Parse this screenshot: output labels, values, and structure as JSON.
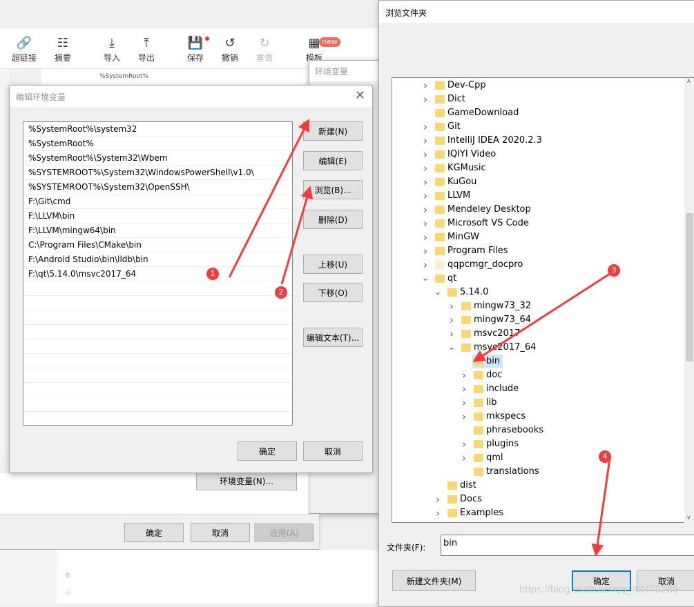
{
  "toolbar": {
    "items": [
      {
        "label": "超链接",
        "icon": "link-icon"
      },
      {
        "label": "摘要",
        "icon": "summary-icon"
      },
      {
        "label": "导入",
        "icon": "import-icon"
      },
      {
        "label": "导出",
        "icon": "export-icon"
      },
      {
        "label": "保存",
        "icon": "save-icon"
      },
      {
        "label": "撤销",
        "icon": "undo-icon"
      },
      {
        "label": "重做",
        "icon": "redo-icon"
      },
      {
        "label": "模板",
        "icon": "template-icon"
      }
    ],
    "new_badge": "new",
    "bg_snippet": "%SystemRoot%"
  },
  "env_dialog": {
    "title": "环境变量",
    "env_button": "环境变量(N)..."
  },
  "sys_dialog": {
    "ok": "确定",
    "cancel": "取消",
    "apply": "应用(A)"
  },
  "edit_dialog": {
    "title": "编辑环境变量",
    "paths": [
      "%SystemRoot%\\system32",
      "%SystemRoot%",
      "%SystemRoot%\\System32\\Wbem",
      "%SYSTEMROOT%\\System32\\WindowsPowerShell\\v1.0\\",
      "%SYSTEMROOT%\\System32\\OpenSSH\\",
      "F:\\Git\\cmd",
      "F:\\LLVM\\bin",
      "F:\\LLVM\\mingw64\\bin",
      "C:\\Program Files\\CMake\\bin",
      "F:\\Android Studio\\bin\\lldb\\bin",
      "F:\\qt\\5.14.0\\msvc2017_64"
    ],
    "buttons": {
      "new": "新建(N)",
      "edit": "编辑(E)",
      "browse": "浏览(B)...",
      "delete": "删除(D)",
      "up": "上移(U)",
      "down": "下移(O)",
      "edit_text": "编辑文本(T)...",
      "ok": "确定",
      "cancel": "取消"
    }
  },
  "browse_dialog": {
    "title": "浏览文件夹",
    "folder_label": "文件夹(F):",
    "folder_value": "bin",
    "new_folder": "新建文件夹(M)",
    "ok": "确定",
    "cancel": "取消",
    "tree": [
      {
        "name": "Dev-Cpp",
        "level": 0,
        "exp": ">"
      },
      {
        "name": "Dict",
        "level": 0,
        "exp": ">"
      },
      {
        "name": "GameDownload",
        "level": 0,
        "exp": ""
      },
      {
        "name": "Git",
        "level": 0,
        "exp": ">"
      },
      {
        "name": "IntelliJ IDEA 2020.2.3",
        "level": 0,
        "exp": ">"
      },
      {
        "name": "IQIYI Video",
        "level": 0,
        "exp": ">"
      },
      {
        "name": "KGMusic",
        "level": 0,
        "exp": ">"
      },
      {
        "name": "KuGou",
        "level": 0,
        "exp": ">"
      },
      {
        "name": "LLVM",
        "level": 0,
        "exp": ">"
      },
      {
        "name": "Mendeley Desktop",
        "level": 0,
        "exp": ">"
      },
      {
        "name": "Microsoft VS Code",
        "level": 0,
        "exp": ">"
      },
      {
        "name": "MinGW",
        "level": 0,
        "exp": ">"
      },
      {
        "name": "Program Files",
        "level": 0,
        "exp": ">"
      },
      {
        "name": "qqpcmgr_docpro",
        "level": 0,
        "exp": ">",
        "faint": true
      },
      {
        "name": "qt",
        "level": 0,
        "exp": "v"
      },
      {
        "name": "5.14.0",
        "level": 1,
        "exp": "v"
      },
      {
        "name": "mingw73_32",
        "level": 2,
        "exp": ">"
      },
      {
        "name": "mingw73_64",
        "level": 2,
        "exp": ">"
      },
      {
        "name": "msvc2017",
        "level": 2,
        "exp": ">"
      },
      {
        "name": "msvc2017_64",
        "level": 2,
        "exp": "v"
      },
      {
        "name": "bin",
        "level": 3,
        "exp": "",
        "selected": true
      },
      {
        "name": "doc",
        "level": 3,
        "exp": ">"
      },
      {
        "name": "include",
        "level": 3,
        "exp": ">"
      },
      {
        "name": "lib",
        "level": 3,
        "exp": ">"
      },
      {
        "name": "mkspecs",
        "level": 3,
        "exp": ">"
      },
      {
        "name": "phrasebooks",
        "level": 3,
        "exp": ""
      },
      {
        "name": "plugins",
        "level": 3,
        "exp": ">"
      },
      {
        "name": "qml",
        "level": 3,
        "exp": ">"
      },
      {
        "name": "translations",
        "level": 3,
        "exp": ""
      },
      {
        "name": "dist",
        "level": 1,
        "exp": ""
      },
      {
        "name": "Docs",
        "level": 1,
        "exp": ">"
      },
      {
        "name": "Examples",
        "level": 1,
        "exp": ">"
      }
    ]
  },
  "annotations": [
    "1",
    "2",
    "3",
    "4"
  ],
  "watermark": "https://blog.csdn.net/qq_43475285",
  "colors": {
    "arrow": "#f23c3c",
    "selection": "#cce8ff",
    "accent": "#0078d7"
  }
}
